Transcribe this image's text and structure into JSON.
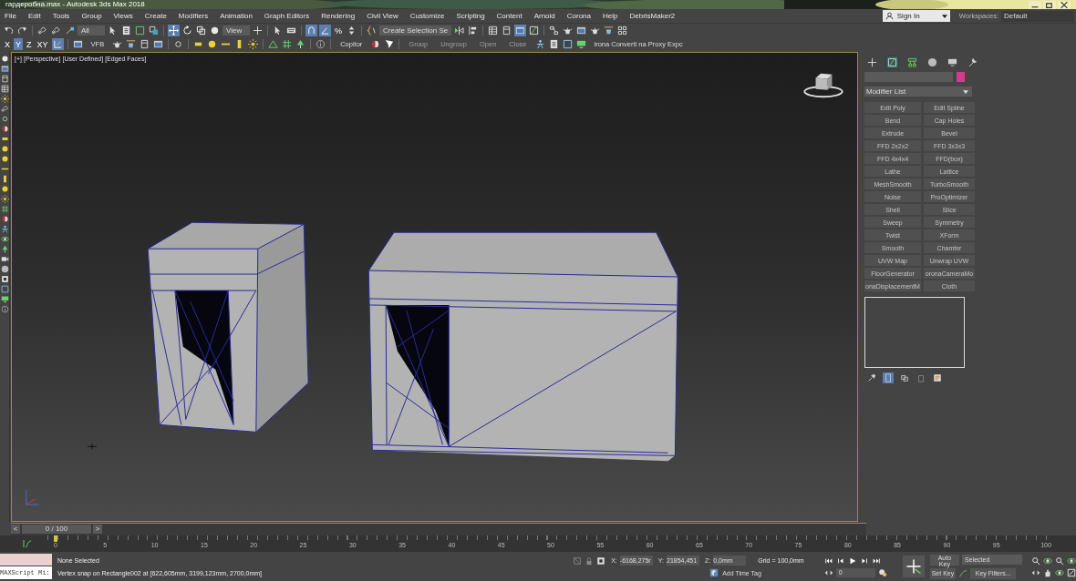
{
  "window": {
    "title": "гардеробна.max - Autodesk 3ds Max 2018"
  },
  "menu": [
    "File",
    "Edit",
    "Tools",
    "Group",
    "Views",
    "Create",
    "Modifiers",
    "Animation",
    "Graph Editors",
    "Rendering",
    "Civil View",
    "Customize",
    "Scripting",
    "Content",
    "Arnold",
    "Corona",
    "Help",
    "DebrisMaker2"
  ],
  "sign_in": {
    "label": "Sign In"
  },
  "workspaces": {
    "label": "Workspaces:",
    "value": "Default"
  },
  "main_toolbar": [
    {
      "kind": "icon",
      "selected": false
    },
    {
      "kind": "icon",
      "selected": false
    },
    {
      "kind": "separator"
    },
    {
      "kind": "icon",
      "selected": false
    },
    {
      "kind": "icon",
      "selected": false
    },
    {
      "kind": "icon",
      "selected": false
    },
    {
      "kind": "dropdown",
      "value": "All"
    },
    {
      "kind": "icon",
      "selected": false
    },
    {
      "kind": "icon",
      "selected": false
    },
    {
      "kind": "icon",
      "selected": false
    },
    {
      "kind": "icon",
      "selected": false
    },
    {
      "kind": "separator"
    },
    {
      "kind": "icon",
      "selected": true
    },
    {
      "kind": "icon",
      "selected": false
    },
    {
      "kind": "icon",
      "selected": false
    },
    {
      "kind": "icon",
      "selected": false
    },
    {
      "kind": "dropdown",
      "value": "View"
    },
    {
      "kind": "icon",
      "selected": false
    },
    {
      "kind": "separator"
    },
    {
      "kind": "icon",
      "selected": false
    },
    {
      "kind": "icon",
      "selected": false
    },
    {
      "kind": "separator"
    },
    {
      "kind": "icon",
      "selected": true
    },
    {
      "kind": "icon",
      "selected": true
    },
    {
      "kind": "glyph",
      "text": "%",
      "selected": false
    },
    {
      "kind": "icon",
      "selected": false
    },
    {
      "kind": "separator"
    },
    {
      "kind": "icon",
      "selected": false
    },
    {
      "kind": "dropdown",
      "value": "Create Selection Se"
    },
    {
      "kind": "icon",
      "selected": false
    },
    {
      "kind": "icon",
      "selected": false
    },
    {
      "kind": "separator"
    },
    {
      "kind": "icon",
      "selected": false
    },
    {
      "kind": "icon",
      "selected": false
    },
    {
      "kind": "icon",
      "selected": true
    },
    {
      "kind": "icon",
      "selected": false
    },
    {
      "kind": "separator"
    },
    {
      "kind": "icon",
      "selected": false
    },
    {
      "kind": "icon",
      "selected": false
    },
    {
      "kind": "icon",
      "selected": false
    },
    {
      "kind": "icon",
      "selected": false
    },
    {
      "kind": "icon",
      "selected": false
    },
    {
      "kind": "icon",
      "selected": false
    }
  ],
  "secondary_toolbar": [
    {
      "kind": "glyph",
      "text": "X",
      "selected": false
    },
    {
      "kind": "glyph",
      "text": "Y",
      "selected": true
    },
    {
      "kind": "glyph",
      "text": "Z",
      "selected": false
    },
    {
      "kind": "glyph",
      "text": "XY",
      "selected": false
    },
    {
      "kind": "icon",
      "selected": true
    },
    {
      "kind": "separator"
    },
    {
      "kind": "icon",
      "selected": false
    },
    {
      "kind": "label",
      "text": "VFB",
      "disabled": false
    },
    {
      "kind": "icon",
      "selected": false
    },
    {
      "kind": "icon",
      "selected": false
    },
    {
      "kind": "icon",
      "selected": false
    },
    {
      "kind": "icon",
      "selected": false
    },
    {
      "kind": "separator"
    },
    {
      "kind": "icon",
      "selected": false
    },
    {
      "kind": "separator"
    },
    {
      "kind": "icon",
      "selected": false
    },
    {
      "kind": "icon",
      "selected": false
    },
    {
      "kind": "icon",
      "selected": false
    },
    {
      "kind": "icon",
      "selected": false
    },
    {
      "kind": "icon",
      "selected": false
    },
    {
      "kind": "separator"
    },
    {
      "kind": "icon",
      "selected": false
    },
    {
      "kind": "icon",
      "selected": false
    },
    {
      "kind": "icon",
      "selected": false
    },
    {
      "kind": "separator"
    },
    {
      "kind": "icon",
      "selected": false
    },
    {
      "kind": "separator"
    },
    {
      "kind": "label",
      "text": "Copitor",
      "disabled": false
    },
    {
      "kind": "icon",
      "selected": false
    },
    {
      "kind": "icon",
      "selected": false
    },
    {
      "kind": "separator"
    },
    {
      "kind": "label",
      "text": "Group",
      "disabled": true
    },
    {
      "kind": "label",
      "text": "Ungroup",
      "disabled": true
    },
    {
      "kind": "label",
      "text": "Open",
      "disabled": true
    },
    {
      "kind": "label",
      "text": "Close",
      "disabled": true
    },
    {
      "kind": "icon",
      "selected": false
    },
    {
      "kind": "icon",
      "selected": false
    },
    {
      "kind": "icon",
      "selected": false
    },
    {
      "kind": "icon",
      "selected": false
    },
    {
      "kind": "label",
      "text": "irona Converti na Proxy Expc",
      "disabled": false
    }
  ],
  "viewport": {
    "labels": [
      "[+]",
      "[Perspective]",
      "[User Defined]",
      "[Edged Faces]"
    ]
  },
  "command_panel": {
    "tabs": [
      {
        "selected": false
      },
      {
        "selected": true
      },
      {
        "selected": false
      },
      {
        "selected": false
      },
      {
        "selected": false
      },
      {
        "selected": false
      }
    ],
    "modifier_list": {
      "value": "Modifier List"
    },
    "modifier_buttons": [
      {
        "label": "Edit Poly",
        "disabled": true
      },
      {
        "label": "Edit Spline",
        "disabled": true
      },
      {
        "label": "Bend",
        "disabled": true
      },
      {
        "label": "Cap Holes",
        "disabled": true
      },
      {
        "label": "Extrude",
        "disabled": true
      },
      {
        "label": "Bevel",
        "disabled": true
      },
      {
        "label": "FFD 2x2x2",
        "disabled": true
      },
      {
        "label": "FFD 3x3x3",
        "disabled": true
      },
      {
        "label": "FFD 4x4x4",
        "disabled": true
      },
      {
        "label": "FFD(box)",
        "disabled": true
      },
      {
        "label": "Lathe",
        "disabled": true
      },
      {
        "label": "Lattice",
        "disabled": true
      },
      {
        "label": "MeshSmooth",
        "disabled": true
      },
      {
        "label": "TurboSmooth",
        "disabled": true
      },
      {
        "label": "Noise",
        "disabled": true
      },
      {
        "label": "ProOptimizer",
        "disabled": true
      },
      {
        "label": "Shell",
        "disabled": true
      },
      {
        "label": "Slice",
        "disabled": true
      },
      {
        "label": "Sweep",
        "disabled": true
      },
      {
        "label": "Symmetry",
        "disabled": true
      },
      {
        "label": "Twist",
        "disabled": true
      },
      {
        "label": "XForm",
        "disabled": true
      },
      {
        "label": "Smooth",
        "disabled": true
      },
      {
        "label": "Chamfer",
        "disabled": true
      },
      {
        "label": "UVW Map",
        "disabled": true
      },
      {
        "label": "Unwrap UVW",
        "disabled": true
      },
      {
        "label": "FloorGenerator",
        "disabled": true
      },
      {
        "label": "oronaCameraMo",
        "disabled": true
      },
      {
        "label": "onaDisplacementM",
        "disabled": true
      },
      {
        "label": "Cloth",
        "disabled": true
      }
    ],
    "stack_tools": [
      {
        "selected": false
      },
      {
        "selected": true
      },
      {
        "selected": false
      },
      {
        "selected": false
      },
      {
        "selected": false
      }
    ]
  },
  "time_slider": {
    "prev": "<",
    "label": "0 / 100",
    "next": ">",
    "level": 0
  },
  "timeline": {
    "labels": [
      "0",
      "5",
      "10",
      "15",
      "20",
      "25",
      "30",
      "35",
      "40",
      "45",
      "50",
      "55",
      "60",
      "65",
      "70",
      "75",
      "80",
      "85",
      "90",
      "95",
      "100"
    ]
  },
  "maxscript": {
    "value": "MAXScript Mi:"
  },
  "status": {
    "selection": "None Selected",
    "prompt": "Vertex snap on Rectangle002 at [622,605mm, 3199,123mm, 2700,0mm]"
  },
  "coordinates": [
    {
      "axis": "X:",
      "value": "-6168,275r"
    },
    {
      "axis": "Y:",
      "value": "21854,451"
    },
    {
      "axis": "Z:",
      "value": "0,0mm"
    }
  ],
  "grid": "Grid = 100,0mm",
  "time_tag": "Add Time Tag",
  "frame_field": {
    "value": "0"
  },
  "auto_key": "Auto Key",
  "set_key": "Set Key",
  "key_mode": {
    "value": "Selected"
  },
  "key_filters": "Key Filters..."
}
